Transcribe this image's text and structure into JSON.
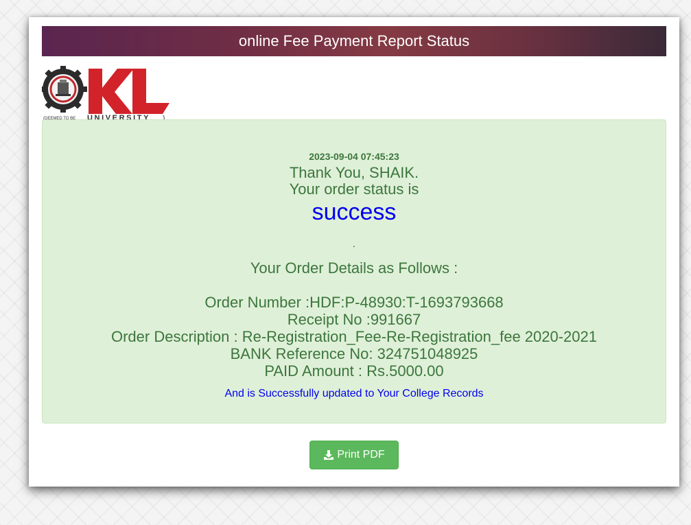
{
  "header": {
    "title": "online Fee Payment Report Status"
  },
  "logo": {
    "letters": "KL",
    "tagline": "UNIVERSITY",
    "deemed": "(DEEMED TO BE",
    "close_paren": ")"
  },
  "receipt": {
    "timestamp": "2023-09-04 07:45:23",
    "thanks": "Thank You, SHAIK.",
    "status_prefix": "Your order status is",
    "status": "success",
    "dot": ".",
    "details_heading": "Your Order Details as Follows :",
    "order_number": "Order Number :HDF:P-48930:T-1693793668",
    "receipt_no": "Receipt No :991667",
    "order_description": "Order Description : Re-Registration_Fee-Re-Registration_fee 2020-2021",
    "bank_reference": "BANK Reference No: 324751048925",
    "paid_amount": "PAID Amount : Rs.5000.00",
    "updated_note": "And is Successfully updated to Your College Records"
  },
  "actions": {
    "print_label": "Print PDF",
    "print_icon": "download-icon"
  },
  "colors": {
    "success_text": "#3c763d",
    "success_bg": "#dff0d8",
    "link_blue": "#0000ee",
    "button_green": "#5cb85c",
    "logo_red": "#d2232a"
  }
}
